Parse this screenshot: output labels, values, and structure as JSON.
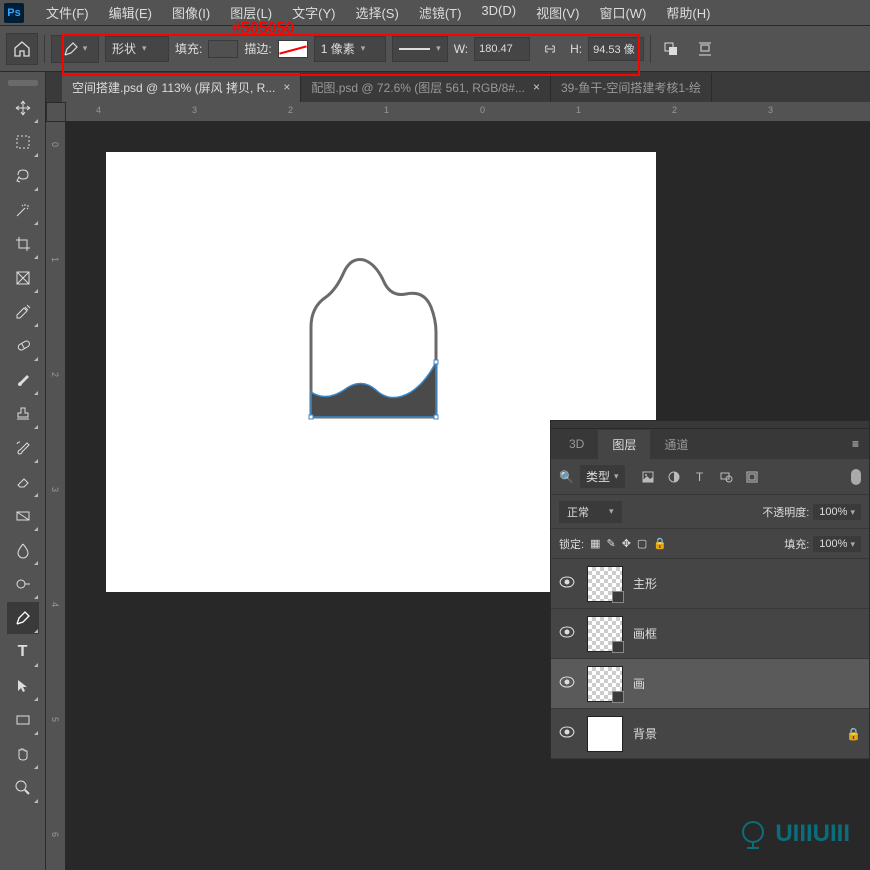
{
  "annotation": {
    "color_label": "#505050"
  },
  "menubar": {
    "items": [
      "文件(F)",
      "编辑(E)",
      "图像(I)",
      "图层(L)",
      "文字(Y)",
      "选择(S)",
      "滤镜(T)",
      "3D(D)",
      "视图(V)",
      "窗口(W)",
      "帮助(H)"
    ]
  },
  "options": {
    "mode_label": "形状",
    "fill_label": "填充:",
    "stroke_label": "描边:",
    "stroke_width": "1 像素",
    "w_label": "W:",
    "w_value": "180.47",
    "h_label": "H:",
    "h_value": "94.53 像"
  },
  "tabs": [
    {
      "label": "空间搭建.psd @ 113% (屏风 拷贝, R...",
      "active": true
    },
    {
      "label": "配图.psd @ 72.6% (图层 561, RGB/8#...",
      "active": false
    },
    {
      "label": "39-鱼干-空间搭建考核1-绘",
      "active": false,
      "noclose": true
    }
  ],
  "ruler_h": [
    "4",
    "3",
    "2",
    "1",
    "0",
    "1",
    "2",
    "3"
  ],
  "ruler_v": [
    "0",
    "1",
    "2",
    "3",
    "4",
    "5",
    "6"
  ],
  "panels": {
    "tabs": [
      "3D",
      "图层",
      "通道"
    ],
    "active_tab": "图层",
    "filter_label": "类型",
    "blend_mode": "正常",
    "opacity_label": "不透明度:",
    "opacity_value": "100%",
    "lock_label": "锁定:",
    "fill_label": "填充:",
    "fill_value": "100%",
    "layers": [
      {
        "name": "主形",
        "selected": false,
        "thumb": "checker"
      },
      {
        "name": "画框",
        "selected": false,
        "thumb": "checker"
      },
      {
        "name": "画",
        "selected": true,
        "thumb": "checker"
      },
      {
        "name": "背景",
        "selected": false,
        "thumb": "white",
        "locked": true
      }
    ]
  },
  "watermark": "UIIIUIII"
}
